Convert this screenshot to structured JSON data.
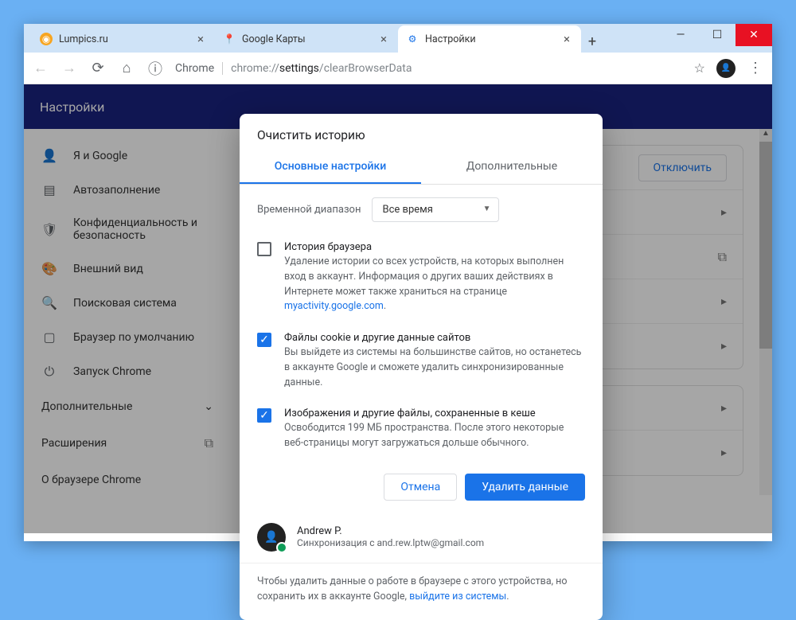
{
  "tabs": [
    {
      "title": "Lumpics.ru",
      "favicon_color": "#f7a521"
    },
    {
      "title": "Google Карты",
      "favicon_color": "#4285f4"
    },
    {
      "title": "Настройки",
      "favicon_color": "#1a73e8"
    }
  ],
  "addressbar": {
    "chip": "Chrome",
    "url_gray": "chrome://",
    "url_host": "settings",
    "url_path": "/clearBrowserData"
  },
  "settings_bar_title": "Настройки",
  "sidebar": {
    "items": [
      {
        "label": "Я и Google"
      },
      {
        "label": "Автозаполнение"
      },
      {
        "label": "Конфиденциальность и безопасность"
      },
      {
        "label": "Внешний вид"
      },
      {
        "label": "Поисковая система"
      },
      {
        "label": "Браузер по умолчанию"
      },
      {
        "label": "Запуск Chrome"
      }
    ],
    "advanced": "Дополнительные",
    "extensions": "Расширения",
    "about": "О браузере Chrome"
  },
  "main": {
    "disconnect": "Отключить"
  },
  "dialog": {
    "title": "Очистить историю",
    "tab_basic": "Основные настройки",
    "tab_advanced": "Дополнительные",
    "time_label": "Временной диапазон",
    "time_value": "Все время",
    "options": [
      {
        "title": "История браузера",
        "desc_pre": "Удаление истории со всех устройств, на которых выполнен вход в аккаунт. Информация о других ваших действиях в Интернете может также храниться на странице ",
        "desc_link": "myactivity.google.com",
        "desc_post": ".",
        "checked": false
      },
      {
        "title": "Файлы cookie и другие данные сайтов",
        "desc_pre": "Вы выйдете из системы на большинстве сайтов, но останетесь в аккаунте Google и сможете удалить синхронизированные данные.",
        "desc_link": "",
        "desc_post": "",
        "checked": true
      },
      {
        "title": "Изображения и другие файлы, сохраненные в кеше",
        "desc_pre": "Освободится 199 МБ пространства. После этого некоторые веб-страницы могут загружаться дольше обычного.",
        "desc_link": "",
        "desc_post": "",
        "checked": true
      }
    ],
    "cancel": "Отмена",
    "confirm": "Удалить данные",
    "user_name": "Andrew P.",
    "user_sync": "Синхронизация с and.rew.lptw@gmail.com",
    "footer_pre": "Чтобы удалить данные о работе в браузере с этого устройства, но сохранить их в аккаунте Google, ",
    "footer_link": "выйдите из системы",
    "footer_post": "."
  }
}
